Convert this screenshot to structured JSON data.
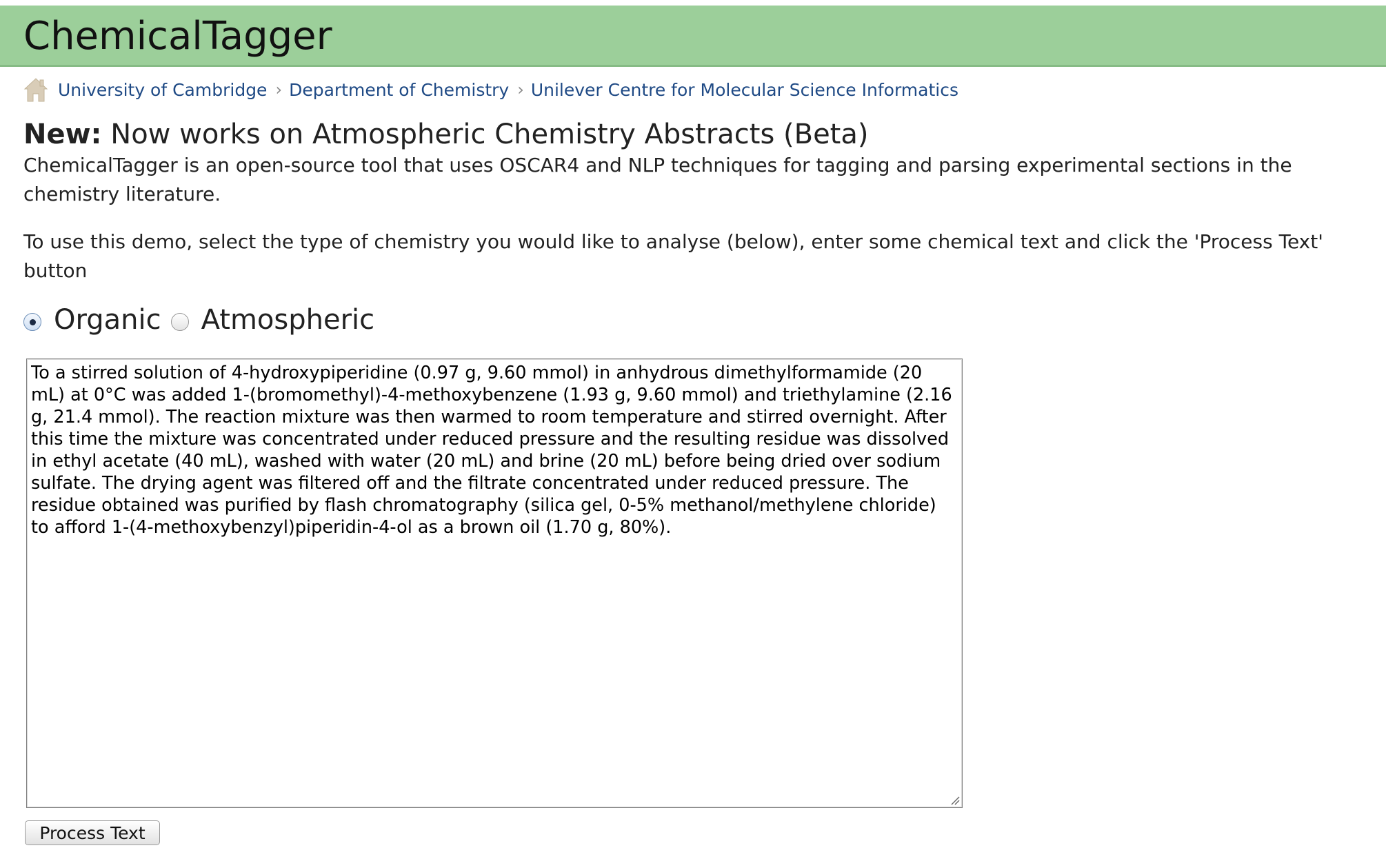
{
  "header": {
    "title": "ChemicalTagger",
    "background_color": "#9ccf9a"
  },
  "breadcrumb": {
    "home_icon": "home-icon",
    "separator": "›",
    "items": [
      {
        "label": "University of Cambridge"
      },
      {
        "label": "Department of Chemistry"
      },
      {
        "label": "Unilever Centre for Molecular Science Informatics"
      }
    ],
    "link_color": "#1f4a85"
  },
  "main": {
    "headline_bold": "New:",
    "headline_rest": " Now works on Atmospheric Chemistry Abstracts (Beta)",
    "intro": "ChemicalTagger is an open-source tool that uses OSCAR4 and NLP techniques for tagging and parsing experimental sections in the chemistry literature.",
    "instructions": "To use this demo, select the type of chemistry you would like to analyse (below), enter some chemical text and click the 'Process Text' button"
  },
  "chemistry_type": {
    "options": [
      {
        "label": "Organic",
        "selected": true
      },
      {
        "label": "Atmospheric",
        "selected": false
      }
    ]
  },
  "input": {
    "text": "To a stirred solution of 4-hydroxypiperidine (0.97 g, 9.60 mmol) in anhydrous dimethylformamide (20 mL) at 0°C was added 1-(bromomethyl)-4-methoxybenzene (1.93 g, 9.60 mmol) and triethylamine (2.16 g, 21.4 mmol). The reaction mixture was then warmed to room temperature and stirred overnight. After this time the mixture was concentrated under reduced pressure and the resulting residue was dissolved in ethyl acetate (40 mL), washed with water (20 mL) and brine (20 mL) before being dried over sodium sulfate. The drying agent was filtered off and the filtrate concentrated under reduced pressure. The residue obtained was purified by flash chromatography (silica gel, 0-5% methanol/methylene chloride) to afford 1-(4-methoxybenzyl)piperidin-4-ol as a brown oil (1.70 g, 80%)."
  },
  "actions": {
    "process_label": "Process Text"
  }
}
